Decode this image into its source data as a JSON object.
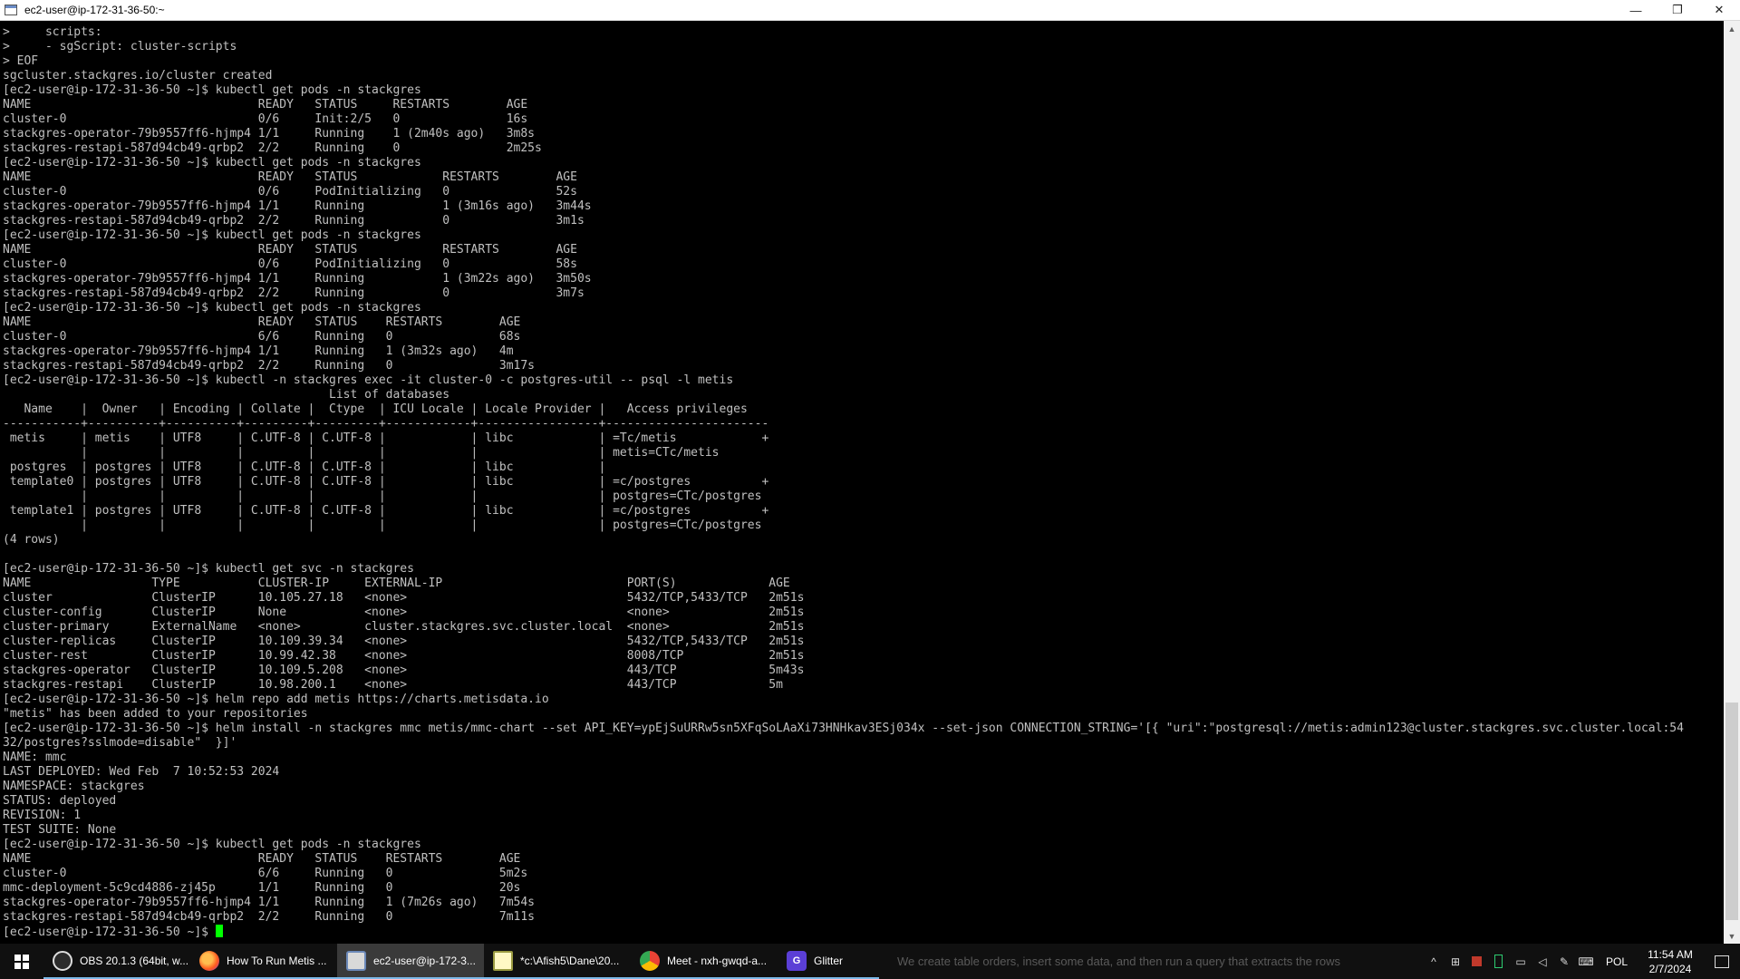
{
  "window": {
    "title": "ec2-user@ip-172-31-36-50:~",
    "minimize": "—",
    "maximize": "❐",
    "close": "✕"
  },
  "terminal": {
    "lines": [
      ">     scripts:",
      ">     - sgScript: cluster-scripts",
      "> EOF",
      "sgcluster.stackgres.io/cluster created",
      "[ec2-user@ip-172-31-36-50 ~]$ kubectl get pods -n stackgres",
      "NAME                                READY   STATUS     RESTARTS        AGE",
      "cluster-0                           0/6     Init:2/5   0               16s",
      "stackgres-operator-79b9557ff6-hjmp4 1/1     Running    1 (2m40s ago)   3m8s",
      "stackgres-restapi-587d94cb49-qrbp2  2/2     Running    0               2m25s",
      "[ec2-user@ip-172-31-36-50 ~]$ kubectl get pods -n stackgres",
      "NAME                                READY   STATUS            RESTARTS        AGE",
      "cluster-0                           0/6     PodInitializing   0               52s",
      "stackgres-operator-79b9557ff6-hjmp4 1/1     Running           1 (3m16s ago)   3m44s",
      "stackgres-restapi-587d94cb49-qrbp2  2/2     Running           0               3m1s",
      "[ec2-user@ip-172-31-36-50 ~]$ kubectl get pods -n stackgres",
      "NAME                                READY   STATUS            RESTARTS        AGE",
      "cluster-0                           0/6     PodInitializing   0               58s",
      "stackgres-operator-79b9557ff6-hjmp4 1/1     Running           1 (3m22s ago)   3m50s",
      "stackgres-restapi-587d94cb49-qrbp2  2/2     Running           0               3m7s",
      "[ec2-user@ip-172-31-36-50 ~]$ kubectl get pods -n stackgres",
      "NAME                                READY   STATUS    RESTARTS        AGE",
      "cluster-0                           6/6     Running   0               68s",
      "stackgres-operator-79b9557ff6-hjmp4 1/1     Running   1 (3m32s ago)   4m",
      "stackgres-restapi-587d94cb49-qrbp2  2/2     Running   0               3m17s",
      "[ec2-user@ip-172-31-36-50 ~]$ kubectl -n stackgres exec -it cluster-0 -c postgres-util -- psql -l metis",
      "                                              List of databases",
      "   Name    |  Owner   | Encoding | Collate |  Ctype  | ICU Locale | Locale Provider |   Access privileges",
      "-----------+----------+----------+---------+---------+------------+-----------------+-----------------------",
      " metis     | metis    | UTF8     | C.UTF-8 | C.UTF-8 |            | libc            | =Tc/metis            +",
      "           |          |          |         |         |            |                 | metis=CTc/metis",
      " postgres  | postgres | UTF8     | C.UTF-8 | C.UTF-8 |            | libc            |",
      " template0 | postgres | UTF8     | C.UTF-8 | C.UTF-8 |            | libc            | =c/postgres          +",
      "           |          |          |         |         |            |                 | postgres=CTc/postgres",
      " template1 | postgres | UTF8     | C.UTF-8 | C.UTF-8 |            | libc            | =c/postgres          +",
      "           |          |          |         |         |            |                 | postgres=CTc/postgres",
      "(4 rows)",
      "",
      "[ec2-user@ip-172-31-36-50 ~]$ kubectl get svc -n stackgres",
      "NAME                 TYPE           CLUSTER-IP     EXTERNAL-IP                          PORT(S)             AGE",
      "cluster              ClusterIP      10.105.27.18   <none>                               5432/TCP,5433/TCP   2m51s",
      "cluster-config       ClusterIP      None           <none>                               <none>              2m51s",
      "cluster-primary      ExternalName   <none>         cluster.stackgres.svc.cluster.local  <none>              2m51s",
      "cluster-replicas     ClusterIP      10.109.39.34   <none>                               5432/TCP,5433/TCP   2m51s",
      "cluster-rest         ClusterIP      10.99.42.38    <none>                               8008/TCP            2m51s",
      "stackgres-operator   ClusterIP      10.109.5.208   <none>                               443/TCP             5m43s",
      "stackgres-restapi    ClusterIP      10.98.200.1    <none>                               443/TCP             5m",
      "[ec2-user@ip-172-31-36-50 ~]$ helm repo add metis https://charts.metisdata.io",
      "\"metis\" has been added to your repositories",
      "[ec2-user@ip-172-31-36-50 ~]$ helm install -n stackgres mmc metis/mmc-chart --set API_KEY=ypEjSuURRw5sn5XFqSoLAaXi73HNHkav3ESj034x --set-json CONNECTION_STRING='[{ \"uri\":\"postgresql://metis:admin123@cluster.stackgres.svc.cluster.local:54",
      "32/postgres?sslmode=disable\"  }]'",
      "NAME: mmc",
      "LAST DEPLOYED: Wed Feb  7 10:52:53 2024",
      "NAMESPACE: stackgres",
      "STATUS: deployed",
      "REVISION: 1",
      "TEST SUITE: None",
      "[ec2-user@ip-172-31-36-50 ~]$ kubectl get pods -n stackgres",
      "NAME                                READY   STATUS    RESTARTS        AGE",
      "cluster-0                           6/6     Running   0               5m2s",
      "mmc-deployment-5c9cd4886-zj45p      1/1     Running   0               20s",
      "stackgres-operator-79b9557ff6-hjmp4 1/1     Running   1 (7m26s ago)   7m54s",
      "stackgres-restapi-587d94cb49-qrbp2  2/2     Running   0               7m11s"
    ],
    "prompt": "[ec2-user@ip-172-31-36-50 ~]$ "
  },
  "scrollbar": {
    "up_arrow": "▲",
    "down_arrow": "▼"
  },
  "taskbar": {
    "tasks": [
      {
        "label": "OBS 20.1.3 (64bit, w...",
        "icon": "obs-icon"
      },
      {
        "label": "How To Run Metis ...",
        "icon": "firefox-icon"
      },
      {
        "label": "ec2-user@ip-172-3...",
        "icon": "putty-icon"
      },
      {
        "label": "*c:\\Afish5\\Dane\\20...",
        "icon": "notepad-icon"
      },
      {
        "label": "Meet - nxh-gwqd-a...",
        "icon": "chrome-icon"
      },
      {
        "label": "Glitter",
        "icon": "glitter-icon"
      }
    ],
    "glitter_glyph": "G",
    "background_caption": "We create table orders, insert some data, and then run a query that extracts the rows",
    "tray": {
      "chevron": "^",
      "language": "POL",
      "time": "11:54 AM",
      "date": "2/7/2024"
    }
  },
  "colors": {
    "terminal_background": "#000000",
    "terminal_text": "#c0c0c0",
    "cursor": "#00ff00",
    "taskbar_background": "#101010",
    "active_task_underline": "#7cb9e8"
  }
}
